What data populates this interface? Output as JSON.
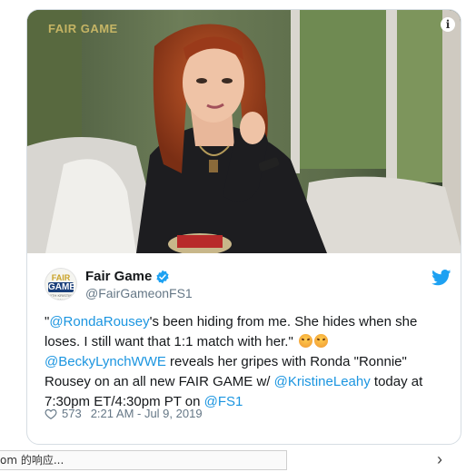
{
  "media": {
    "watermark": "FAIR GAME",
    "info_icon": "info-icon"
  },
  "author": {
    "display_name": "Fair Game",
    "handle": "@FairGameonFS1",
    "logo": {
      "line1": "FAIR",
      "line2": "GAME",
      "line3": "WITH KRISTINE LEAHY"
    },
    "verified_icon": "verified-badge-icon"
  },
  "brand_icon": "twitter-bird-icon",
  "tweet": {
    "seg1": "\"",
    "mention_ronda": "@RondaRousey",
    "seg2": "'s been hiding from me. She hides when she loses. I still want that 1:1 match with her.\" ",
    "mention_becky": "@BeckyLynchWWE",
    "seg3": " reveals her gripes with Ronda \"Ronnie\" Rousey on an all new FAIR GAME w/ ",
    "mention_kristine": "@KristineLeahy",
    "seg4": " today at 7:30pm ET/4:30pm PT on ",
    "mention_fs1": "@FS1"
  },
  "meta": {
    "likes": "573",
    "timestamp": "2:21 AM - Jul 9, 2019"
  },
  "bottom": {
    "response_text": "om 的响应..."
  },
  "colors": {
    "link": "#1b95e0",
    "text": "#14171a",
    "muted": "#657786",
    "verified": "#1da1f2"
  }
}
